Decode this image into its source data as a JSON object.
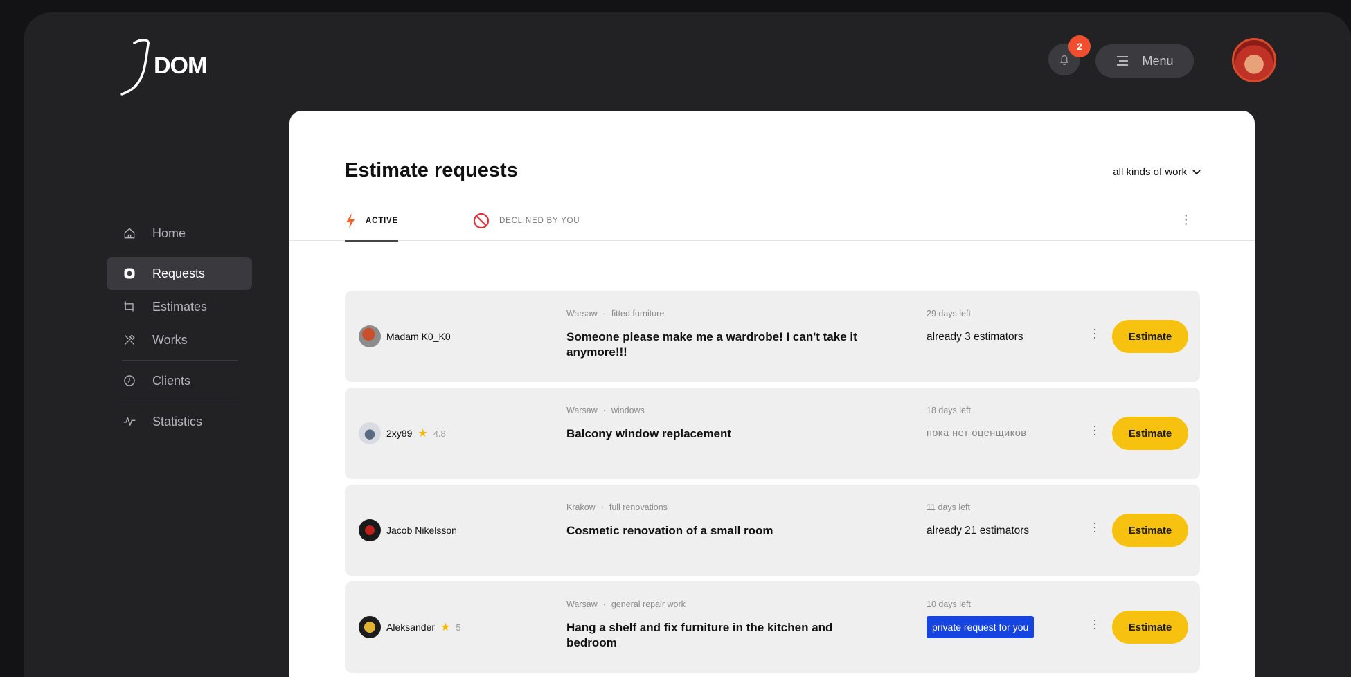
{
  "logo": {
    "text": "DOM"
  },
  "header": {
    "notification_count": "2",
    "menu_label": "Menu"
  },
  "sidebar": {
    "items": [
      {
        "label": "Home",
        "icon": "home-icon"
      },
      {
        "label": "Requests",
        "icon": "requests-icon",
        "active": true
      },
      {
        "label": "Estimates",
        "icon": "estimates-icon"
      },
      {
        "label": "Works",
        "icon": "tools-icon"
      },
      {
        "label": "Clients",
        "icon": "clock-icon"
      },
      {
        "label": "Statistics",
        "icon": "pulse-icon"
      }
    ]
  },
  "main": {
    "title": "Estimate requests",
    "filter": "all kinds of work",
    "tabs": [
      {
        "label": "ACTIVE",
        "icon": "lightning-icon"
      },
      {
        "label": "DECLINED BY YOU",
        "icon": "blocked-icon"
      }
    ],
    "requests": [
      {
        "user": "Madam K0_K0",
        "rating": "",
        "city": "Warsaw",
        "category": "fitted furniture",
        "title": "Someone please make me a wardrobe! I can't take it anymore!!!",
        "days_left": "29 days left",
        "estimators": "already 3 estimators",
        "button": "Estimate"
      },
      {
        "user": "2xy89",
        "rating": "4.8",
        "city": "Warsaw",
        "category": "windows",
        "title": "Balcony window replacement",
        "days_left": "18 days left",
        "estimators": "пока нет оценщиков",
        "button": "Estimate"
      },
      {
        "user": "Jacob Nikelsson",
        "rating": "",
        "city": "Krakow",
        "category": "full renovations",
        "title": "Cosmetic renovation of a small room",
        "days_left": "11 days left",
        "estimators": "already 21 estimators",
        "button": "Estimate"
      },
      {
        "user": "Aleksander",
        "rating": "5",
        "city": "Warsaw",
        "category": "general repair work",
        "title": "Hang a shelf and fix furniture in the kitchen and bedroom",
        "days_left": "10 days left",
        "estimators": "private request for you",
        "button": "Estimate"
      }
    ]
  },
  "colors": {
    "accent_yellow": "#f6c20f",
    "badge_red": "#f04e2e",
    "private_blue": "#1544e0",
    "lightning_orange": "#f0662e",
    "blocked_red": "#e0323c"
  }
}
